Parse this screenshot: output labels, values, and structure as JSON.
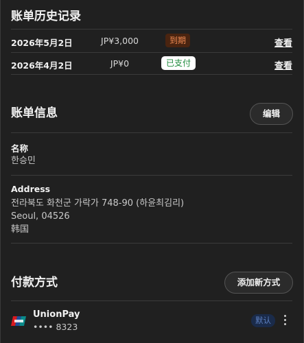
{
  "billing_history": {
    "title": "账单历史记录",
    "rows": [
      {
        "date": "2026年5月2日",
        "amount": "JP¥3,000",
        "status": "到期",
        "action": "查看"
      },
      {
        "date": "2026年4月2日",
        "amount": "JP¥0",
        "status": "已支付",
        "action": "查看"
      }
    ]
  },
  "billing_info": {
    "title": "账单信息",
    "edit_label": "编辑",
    "name_label": "名称",
    "name_value": "한승민",
    "address_label": "Address",
    "address_lines": [
      "전라북도 화천군 가락가 748-90 (하윤최김리)",
      "Seoul, 04526",
      "韩国"
    ]
  },
  "payment_methods": {
    "title": "付款方式",
    "add_label": "添加新方式",
    "cards": [
      {
        "brand": "UnionPay",
        "number": "•••• 8323",
        "badge": "默认",
        "icon": "unionpay-logo-icon"
      }
    ]
  },
  "colors": {
    "background": "#202020",
    "due_badge_bg": "#4a2410",
    "due_badge_text": "#f08b53",
    "paid_badge_bg": "#ffffff",
    "paid_badge_text": "#1e8a3c",
    "default_badge_bg": "#1a2b4a",
    "default_badge_text": "#5d7fbf"
  }
}
